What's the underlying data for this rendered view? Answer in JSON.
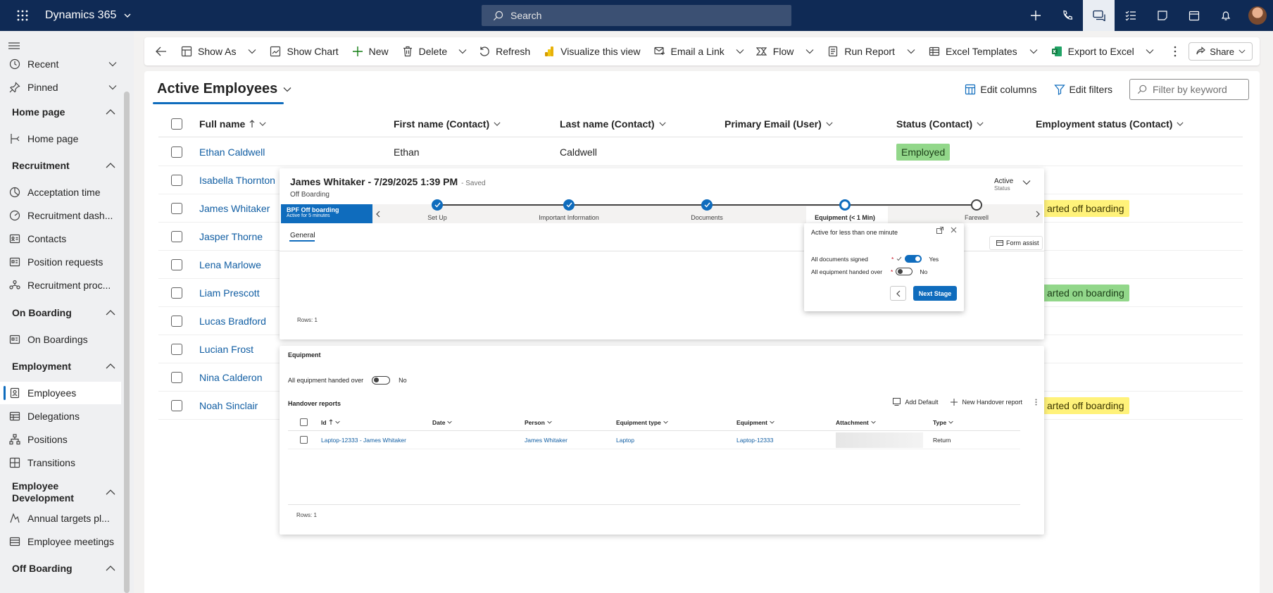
{
  "app": {
    "name": "Dynamics 365",
    "search_placeholder": "Search"
  },
  "sidebar": {
    "items": [
      {
        "label": "Recent"
      },
      {
        "label": "Pinned"
      }
    ],
    "groups": [
      {
        "label": "Home page",
        "items": [
          {
            "label": "Home page",
            "icon": "home-icon"
          }
        ]
      },
      {
        "label": "Recruitment",
        "items": [
          {
            "label": "Acceptation time",
            "icon": "chart-icon"
          },
          {
            "label": "Recruitment dash...",
            "icon": "dashboard-icon"
          },
          {
            "label": "Contacts",
            "icon": "contact-card-icon"
          },
          {
            "label": "Position requests",
            "icon": "document-icon"
          },
          {
            "label": "Recruitment proc...",
            "icon": "people-icon"
          }
        ]
      },
      {
        "label": "On Boarding",
        "items": [
          {
            "label": "On Boardings",
            "icon": "document-icon"
          }
        ]
      },
      {
        "label": "Employment",
        "items": [
          {
            "label": "Employees",
            "icon": "badge-icon"
          },
          {
            "label": "Delegations",
            "icon": "table-icon"
          },
          {
            "label": "Positions",
            "icon": "org-icon"
          },
          {
            "label": "Transitions",
            "icon": "transition-icon"
          }
        ]
      },
      {
        "label": "Employee Development",
        "items": [
          {
            "label": "Annual targets pl...",
            "icon": "target-icon"
          },
          {
            "label": "Employee meetings",
            "icon": "table-icon"
          }
        ]
      },
      {
        "label": "Off Boarding",
        "items": []
      }
    ]
  },
  "commandbar": {
    "show_as": "Show As",
    "show_chart": "Show Chart",
    "new": "New",
    "delete": "Delete",
    "refresh": "Refresh",
    "visualize": "Visualize this view",
    "email_link": "Email a Link",
    "flow": "Flow",
    "run_report": "Run Report",
    "excel_templates": "Excel Templates",
    "export_excel": "Export to Excel",
    "share": "Share"
  },
  "view": {
    "title": "Active Employees",
    "edit_columns": "Edit columns",
    "edit_filters": "Edit filters",
    "filter_placeholder": "Filter by keyword"
  },
  "grid": {
    "columns": [
      "Full name",
      "First name (Contact)",
      "Last name (Contact)",
      "Primary Email (User)",
      "Status (Contact)",
      "Employment status (Contact)"
    ],
    "rows": [
      {
        "full_name": "Ethan Caldwell",
        "first_name": "Ethan",
        "last_name": "Caldwell",
        "status": "Employed",
        "employment_status": ""
      },
      {
        "full_name": "Isabella Thornton",
        "first_name": "",
        "last_name": "",
        "status": "",
        "employment_status": ""
      },
      {
        "full_name": "James Whitaker",
        "first_name": "",
        "last_name": "",
        "status": "",
        "employment_status": "arted off boarding"
      },
      {
        "full_name": "Jasper Thorne",
        "first_name": "",
        "last_name": "",
        "status": "",
        "employment_status": ""
      },
      {
        "full_name": "Lena Marlowe",
        "first_name": "",
        "last_name": "",
        "status": "",
        "employment_status": ""
      },
      {
        "full_name": "Liam Prescott",
        "first_name": "",
        "last_name": "",
        "status": "",
        "employment_status": "arted on boarding"
      },
      {
        "full_name": "Lucas Bradford",
        "first_name": "",
        "last_name": "",
        "status": "",
        "employment_status": ""
      },
      {
        "full_name": "Lucian Frost",
        "first_name": "",
        "last_name": "",
        "status": "",
        "employment_status": ""
      },
      {
        "full_name": "Nina Calderon",
        "first_name": "",
        "last_name": "",
        "status": "",
        "employment_status": ""
      },
      {
        "full_name": "Noah Sinclair",
        "first_name": "",
        "last_name": "",
        "status": "",
        "employment_status": "arted off boarding"
      }
    ]
  },
  "bpf": {
    "title": "James Whitaker - 7/29/2025 1:39 PM",
    "saved": "- Saved",
    "subtitle": "Off Boarding",
    "status_value": "Active",
    "status_label": "Status",
    "process_name": "BPF Off boarding",
    "process_active": "Active for 5 minutes",
    "stages": [
      "Set Up",
      "Important Information",
      "Documents",
      "Equipment",
      "Farewell"
    ],
    "current_stage_time": "(< 1 Min)",
    "tab": "General",
    "form_assist": "Form assist",
    "rows": "Rows: 1"
  },
  "flyout": {
    "title": "Active for less than one minute",
    "fields": [
      {
        "label": "All documents signed",
        "value": "Yes",
        "on": true
      },
      {
        "label": "All equipment handed over",
        "value": "No",
        "on": false
      }
    ],
    "next": "Next Stage"
  },
  "equipment": {
    "title": "Equipment",
    "field_label": "All equipment handed over",
    "field_value": "No",
    "handover_title": "Handover reports",
    "add_default": "Add Default",
    "new_report": "New Handover report",
    "columns": [
      "Id",
      "Date",
      "Person",
      "Equipment type",
      "Equipment",
      "Attachment",
      "Type"
    ],
    "row": {
      "id": "Laptop-12333 - James Whitaker",
      "date": "",
      "person": "James Whitaker",
      "type_eq": "Laptop",
      "equipment": "Laptop-12333",
      "type": "Return"
    },
    "rows": "Rows: 1"
  }
}
